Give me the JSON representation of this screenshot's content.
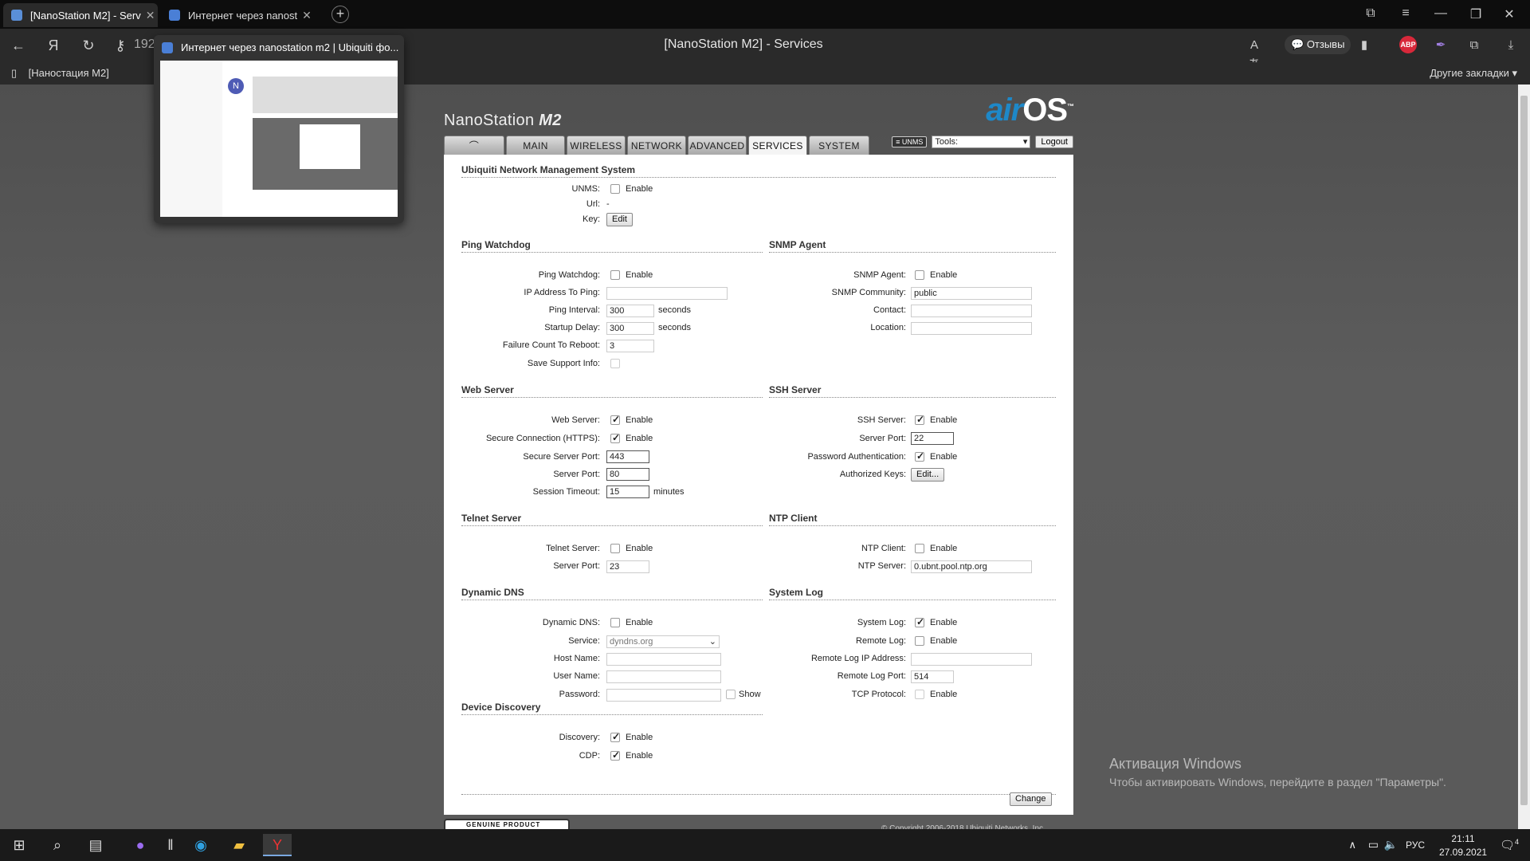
{
  "browser": {
    "tabs": [
      {
        "label": "[NanoStation M2] - Serv",
        "active": true
      },
      {
        "label": "Интернет через nanost",
        "active": false
      }
    ],
    "page_title": "[NanoStation M2] - Services",
    "url_stub": "192",
    "reviews_label": "Отзывы",
    "abp_label": "ABP",
    "bookmark_left": "[Наностация M2]",
    "bookmark_right": "Другие закладки",
    "preview_title": "Интернет через nanostation m2 | Ubiquiti фо...",
    "preview_avatar": "N"
  },
  "device": {
    "brand_name": "NanoStation",
    "brand_model": "M2",
    "airos_air": "air",
    "airos_os": "OS",
    "airos_tm": "™",
    "tabs": [
      "MAIN",
      "WIRELESS",
      "NETWORK",
      "ADVANCED",
      "SERVICES",
      "SYSTEM"
    ],
    "selected_tab": "SERVICES",
    "unms_badge": "≡ UNMS",
    "tools_value": "Tools:",
    "logout_label": "Logout"
  },
  "unms": {
    "title": "Ubiquiti Network Management System",
    "unms_label": "UNMS:",
    "enable": "Enable",
    "url_label": "Url:",
    "url_value": "-",
    "key_label": "Key:",
    "edit_label": "Edit"
  },
  "ping": {
    "title": "Ping Watchdog",
    "watchdog_label": "Ping Watchdog:",
    "enable": "Enable",
    "ip_label": "IP Address To Ping:",
    "ip_value": "",
    "interval_label": "Ping Interval:",
    "interval_value": "300",
    "seconds": "seconds",
    "startup_label": "Startup Delay:",
    "startup_value": "300",
    "failure_label": "Failure Count To Reboot:",
    "failure_value": "3",
    "support_label": "Save Support Info:"
  },
  "snmp": {
    "title": "SNMP Agent",
    "agent_label": "SNMP Agent:",
    "enable": "Enable",
    "community_label": "SNMP Community:",
    "community_value": "public",
    "contact_label": "Contact:",
    "contact_value": "",
    "location_label": "Location:",
    "location_value": ""
  },
  "web": {
    "title": "Web Server",
    "server_label": "Web Server:",
    "enable": "Enable",
    "https_label": "Secure Connection (HTTPS):",
    "secure_port_label": "Secure Server Port:",
    "secure_port_value": "443",
    "port_label": "Server Port:",
    "port_value": "80",
    "timeout_label": "Session Timeout:",
    "timeout_value": "15",
    "minutes": "minutes"
  },
  "ssh": {
    "title": "SSH Server",
    "server_label": "SSH Server:",
    "enable": "Enable",
    "port_label": "Server Port:",
    "port_value": "22",
    "password_label": "Password Authentication:",
    "keys_label": "Authorized Keys:",
    "keys_button": "Edit..."
  },
  "telnet": {
    "title": "Telnet Server",
    "server_label": "Telnet Server:",
    "enable": "Enable",
    "port_label": "Server Port:",
    "port_value": "23"
  },
  "ntp": {
    "title": "NTP Client",
    "client_label": "NTP Client:",
    "enable": "Enable",
    "server_label": "NTP Server:",
    "server_value": "0.ubnt.pool.ntp.org"
  },
  "ddns": {
    "title": "Dynamic DNS",
    "ddns_label": "Dynamic DNS:",
    "enable": "Enable",
    "service_label": "Service:",
    "service_value": "dyndns.org",
    "host_label": "Host Name:",
    "user_label": "User Name:",
    "password_label": "Password:",
    "show_label": "Show"
  },
  "syslog": {
    "title": "System Log",
    "log_label": "System Log:",
    "enable": "Enable",
    "remote_label": "Remote Log:",
    "remote_ip_label": "Remote Log IP Address:",
    "remote_port_label": "Remote Log Port:",
    "remote_port_value": "514",
    "tcp_label": "TCP Protocol:"
  },
  "discovery": {
    "title": "Device Discovery",
    "discovery_label": "Discovery:",
    "enable": "Enable",
    "cdp_label": "CDP:"
  },
  "change_label": "Change",
  "genuine_label": "GENUINE  PRODUCT",
  "copyright": "© Copyright 2006-2018 Ubiquiti Networks, Inc.",
  "activation": {
    "line1": "Активация Windows",
    "line2": "Чтобы активировать Windows, перейдите в раздел \"Параметры\"."
  },
  "taskbar": {
    "lang": "РУС",
    "time": "21:11",
    "date": "27.09.2021",
    "notifications": "4"
  }
}
